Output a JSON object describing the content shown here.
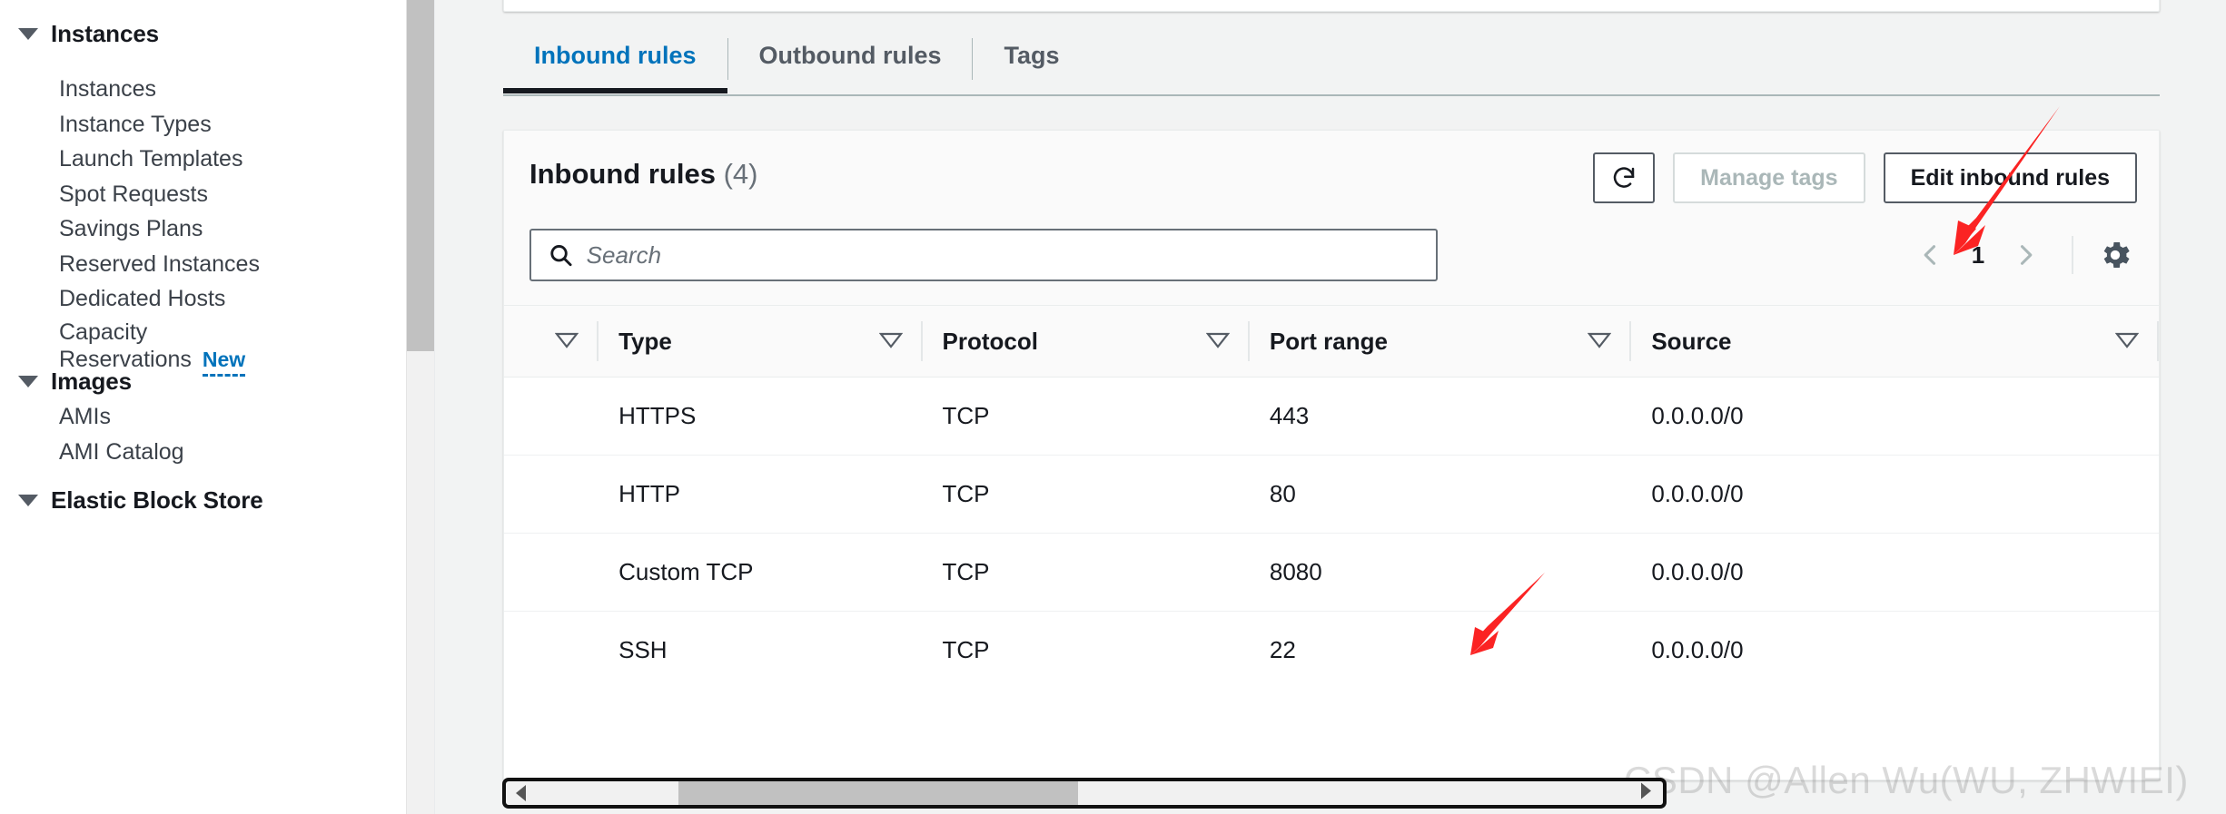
{
  "sidebar": {
    "groups": [
      {
        "label": "Instances",
        "items": [
          {
            "label": "Instances"
          },
          {
            "label": "Instance Types"
          },
          {
            "label": "Launch Templates"
          },
          {
            "label": "Spot Requests"
          },
          {
            "label": "Savings Plans"
          },
          {
            "label": "Reserved Instances"
          },
          {
            "label": "Dedicated Hosts"
          },
          {
            "label": "Capacity Reservations",
            "badge": "New"
          }
        ]
      },
      {
        "label": "Images",
        "items": [
          {
            "label": "AMIs"
          },
          {
            "label": "AMI Catalog"
          }
        ]
      },
      {
        "label": "Elastic Block Store",
        "items": []
      }
    ]
  },
  "tabs": [
    {
      "label": "Inbound rules",
      "active": true
    },
    {
      "label": "Outbound rules",
      "active": false
    },
    {
      "label": "Tags",
      "active": false
    }
  ],
  "card": {
    "title": "Inbound rules",
    "count": "(4)",
    "refresh_icon": "refresh-icon",
    "manage_tags_label": "Manage tags",
    "edit_label": "Edit inbound rules"
  },
  "search": {
    "placeholder": "Search",
    "value": "",
    "icon": "search-icon"
  },
  "pagination": {
    "prev_icon": "chevron-left-icon",
    "page": "1",
    "next_icon": "chevron-right-icon",
    "settings_icon": "gear-icon"
  },
  "table": {
    "columns": [
      "Type",
      "Protocol",
      "Port range",
      "Source"
    ],
    "filter_icon": "filter-triangle-icon",
    "rows": [
      {
        "Type": "HTTPS",
        "Protocol": "TCP",
        "Port range": "443",
        "Source": "0.0.0.0/0"
      },
      {
        "Type": "HTTP",
        "Protocol": "TCP",
        "Port range": "80",
        "Source": "0.0.0.0/0"
      },
      {
        "Type": "Custom TCP",
        "Protocol": "TCP",
        "Port range": "8080",
        "Source": "0.0.0.0/0"
      },
      {
        "Type": "SSH",
        "Protocol": "TCP",
        "Port range": "22",
        "Source": "0.0.0.0/0"
      }
    ]
  },
  "watermark": "CSDN @Allen Wu(WU, ZHWIEI)",
  "annotations": {
    "arrow_color": "#fb2323",
    "arrows": [
      {
        "name": "arrow-to-edit-inbound-rules"
      },
      {
        "name": "arrow-to-port-8080"
      }
    ]
  },
  "colors": {
    "accent_blue": "#0073bb",
    "text_dark": "#16191f",
    "text_muted": "#687078",
    "page_bg": "#f2f3f3",
    "card_bg": "#ffffff"
  }
}
